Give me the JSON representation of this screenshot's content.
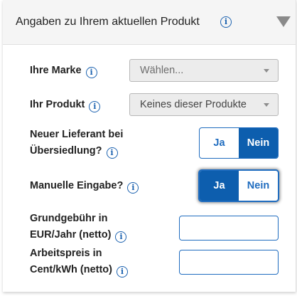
{
  "section": {
    "title": "Angaben zu Ihrem aktuellen Produkt"
  },
  "fields": {
    "brand": {
      "label": "Ihre Marke",
      "value": "Wählen..."
    },
    "product": {
      "label": "Ihr Produkt",
      "value": "Keines dieser Produkte"
    },
    "new_supplier": {
      "label_line1": "Neuer Lieferant bei",
      "label_line2": "Übersiedlung?",
      "option_yes": "Ja",
      "option_no": "Nein",
      "selected": "Nein"
    },
    "manual_entry": {
      "label": "Manuelle Eingabe?",
      "option_yes": "Ja",
      "option_no": "Nein",
      "selected": "Ja"
    },
    "base_fee": {
      "label_line1": "Grundgebühr in",
      "label_line2": "EUR/Jahr (netto)",
      "value": ""
    },
    "energy_price": {
      "label_line1": "Arbeitspreis in",
      "label_line2": "Cent/kWh (netto)",
      "value": ""
    }
  },
  "icons": {
    "info": "info-icon",
    "collapse": "triangle-down-icon",
    "dropdown": "caret-down-icon"
  },
  "colors": {
    "accent": "#0d5eae",
    "header_bg": "#f5f5f5",
    "select_bg": "#ececec"
  }
}
